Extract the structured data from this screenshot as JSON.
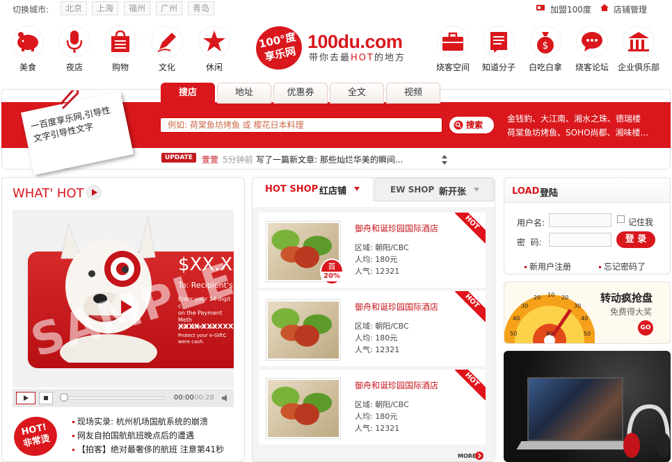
{
  "topbar": {
    "switch_label": "切换城市:",
    "cities": [
      "北京",
      "上海",
      "福州",
      "广州",
      "青岛"
    ],
    "join_label": "加盟100度",
    "shop_manage_label": "店铺管理"
  },
  "logo": {
    "badge_text": "100°度\n享乐网",
    "domain": "100du.com",
    "tagline_pre": "带你去最",
    "tagline_hot": "HOT",
    "tagline_post": "的地方"
  },
  "nav_left": [
    {
      "label": "美食",
      "icon": "piggy-bank-icon"
    },
    {
      "label": "夜店",
      "icon": "microphone-icon"
    },
    {
      "label": "购物",
      "icon": "shopping-bag-icon"
    },
    {
      "label": "文化",
      "icon": "pen-icon"
    },
    {
      "label": "休闲",
      "icon": "star-icon"
    }
  ],
  "nav_right": [
    {
      "label": "烧客空间",
      "icon": "briefcase-icon"
    },
    {
      "label": "知道分子",
      "icon": "notepad-icon"
    },
    {
      "label": "白吃白拿",
      "icon": "money-bag-icon"
    },
    {
      "label": "烧客论坛",
      "icon": "chat-bubble-icon"
    },
    {
      "label": "企业俱乐部",
      "icon": "building-icon"
    }
  ],
  "search": {
    "tabs": [
      "搜店",
      "地址",
      "优惠券",
      "全文",
      "视频"
    ],
    "active_tab": 0,
    "placeholder": "例如: 荷棠鱼坊烤鱼 或 樱花日本料理",
    "button_label": "搜索",
    "hot_line1": "金钱豹、大江南、湘水之珠、德瑞楼",
    "hot_line2": "荷棠鱼坊烤鱼、SOHO尚都、湘味楼..."
  },
  "note_text": "一百度享乐网,引导性文字引导性文字",
  "update": {
    "badge": "UPDATE",
    "user": "萱萱",
    "time": "5分钟前",
    "text": "写了一篇新文章: 那些灿烂华美的瞬间..."
  },
  "whathot": {
    "title": "WHAT' HOT",
    "video_price": "$XX.XX",
    "video_to": "To: Recipient's",
    "video_sample": "SAMPLE",
    "video_lines": [
      "Enter your 14-digit c",
      "on the Payment Meth",
      "you check out."
    ],
    "video_xxxx": "XXXX-XXXXXX",
    "video_protect": [
      "Protect your e-GiftC",
      "were cash."
    ],
    "time_current": "00:00",
    "time_total": "00:28",
    "badge_text": "HOT!\n非常烫",
    "news": [
      "现场实录: 杭州机场国航系统的崩溃",
      "网友自拍国航航班晚点后的遭遇",
      "【拍客】绝对最奢侈的航班 注意第41秒"
    ]
  },
  "hotshop": {
    "tab1_en": "HOT SHOP",
    "tab1_cn": "红店铺",
    "tab2_en": "EW SHOP",
    "tab2_cn": "新开张",
    "items": [
      {
        "name": "御舟和诞珍园国际酒店",
        "area": "区域: 朝阳/CBC",
        "avg": "人均: 180元",
        "pop": "人气: 12321",
        "ribbon": "HOT",
        "discount_top": "首",
        "discount": "20%"
      },
      {
        "name": "御舟和诞珍园国际酒店",
        "area": "区域: 朝阳/CBC",
        "avg": "人均: 180元",
        "pop": "人气: 12321",
        "ribbon": "HOT"
      },
      {
        "name": "御舟和诞珍园国际酒店",
        "area": "区域: 朝阳/CBC",
        "avg": "人均: 180元",
        "pop": "人气: 12321",
        "ribbon": "HOT"
      }
    ],
    "more_label": "MORE"
  },
  "login": {
    "title_en": "LOAD",
    "title_cn": "登陆",
    "user_label": "用户名:",
    "pwd_label": "密  码:",
    "remember_label": "记住我",
    "login_button": "登 录",
    "register_link": "新用户注册",
    "forgot_link": "忘记密码了"
  },
  "lottery": {
    "title": "转动疯抢盘",
    "subtitle": "免费得大奖",
    "go_label": "GO",
    "wheel_numbers": [
      "50",
      "40",
      "30",
      "20",
      "10",
      "20",
      "30",
      "40",
      "50",
      "80"
    ]
  },
  "colors": {
    "brand_red": "#d9171c",
    "dark_red": "#c5131a"
  }
}
